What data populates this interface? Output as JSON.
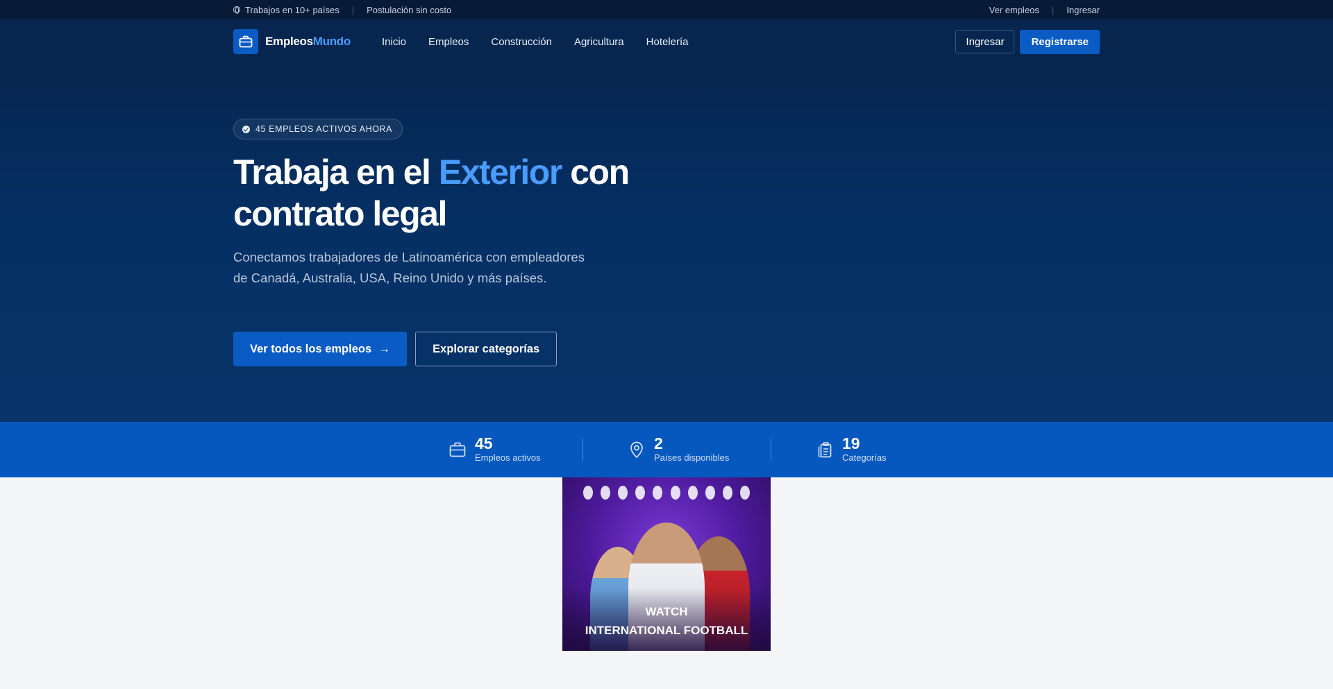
{
  "topbar": {
    "countries": "Trabajos en 10+ países",
    "no_cost": "Postulación sin costo",
    "see_jobs": "Ver empleos",
    "login": "Ingresar"
  },
  "nav": {
    "logo_a": "Empleos",
    "logo_b": "Mundo",
    "links": [
      "Inicio",
      "Empleos",
      "Construcción",
      "Agricultura",
      "Hotelería"
    ],
    "login_button": "Ingresar",
    "register_button": "Registrarse"
  },
  "hero": {
    "badge": "45 EMPLEOS ACTIVOS AHORA",
    "headline_a": "Trabaja en el",
    "headline_accent": "Exterior",
    "headline_b": "con contrato legal",
    "subtitle": "Conectamos trabajadores de Latinoamérica con empleadores de Canadá, Australia, USA, Reino Unido y más países.",
    "cta_primary": "Ver todos los empleos",
    "cta_secondary": "Explorar categorías"
  },
  "stats": [
    {
      "value": "45",
      "label": "Empleos activos",
      "icon": "briefcase-icon"
    },
    {
      "value": "2",
      "label": "Países disponibles",
      "icon": "map-pin-icon"
    },
    {
      "value": "19",
      "label": "Categorías",
      "icon": "clipboard-icon"
    }
  ],
  "ad": {
    "line1": "WATCH",
    "line2": "INTERNATIONAL FOOTBALL"
  },
  "colors": {
    "navy": "#062650",
    "primary": "#0a5bc4",
    "accent": "#4a9cff",
    "stats_band": "#0658be"
  }
}
